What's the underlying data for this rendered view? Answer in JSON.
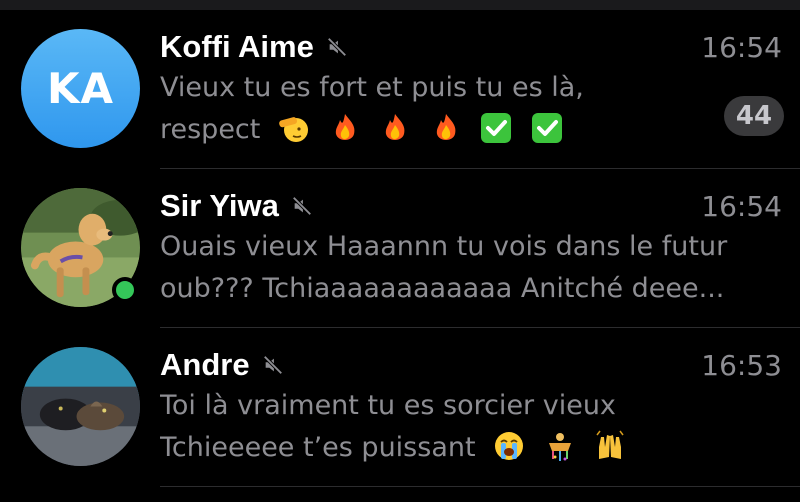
{
  "chats": [
    {
      "name": "Koffi Aime",
      "muted": true,
      "time": "16:54",
      "avatar": {
        "type": "initials",
        "initials": "KA",
        "color": "#3ea6f3"
      },
      "preview_line1": "Vieux tu es fort et puis tu es là,",
      "preview_line2": "respect",
      "preview_emojis": [
        "saluting-face-icon",
        "fire-icon",
        "fire-icon",
        "fire-icon",
        "check-mark-button-icon",
        "check-mark-button-icon"
      ],
      "unread_count": "44",
      "online": false
    },
    {
      "name": "Sir Yiwa",
      "muted": true,
      "time": "16:54",
      "avatar": {
        "type": "photo",
        "subject": "dog-on-grass"
      },
      "preview_line1": "Ouais vieux Haaannn tu vois dans le futur",
      "preview_line2": "oub??? Tchiaaaaaaaaaaaa Anitché deee...",
      "online": true
    },
    {
      "name": "Andre",
      "muted": true,
      "time": "16:53",
      "avatar": {
        "type": "photo",
        "subject": "cats-on-couch"
      },
      "preview_line1": "Toi là vraiment tu es sorcier vieux",
      "preview_line2": "Tchieeeee t’es puissant",
      "preview_emojis": [
        "loudly-crying-face-icon",
        "confetti-ball-icon",
        "raising-hands-icon"
      ],
      "online": false
    }
  ]
}
